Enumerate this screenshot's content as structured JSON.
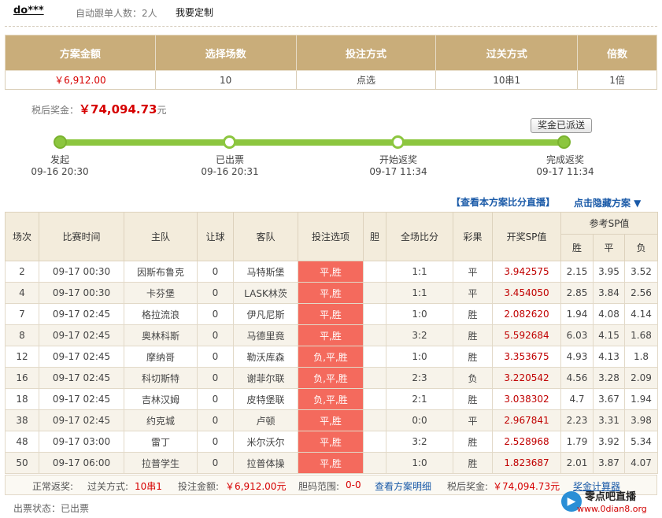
{
  "header": {
    "user": "do***",
    "auto_follow": "自动跟单人数：2人",
    "custom": "我要定制"
  },
  "summary": {
    "headers": [
      "方案金额",
      "选择场数",
      "投注方式",
      "过关方式",
      "倍数"
    ],
    "values": [
      "￥6,912.00",
      "10",
      "点选",
      "10串1",
      "1倍"
    ]
  },
  "prize": {
    "label": "税后奖金：",
    "amount": "￥74,094.73",
    "unit": "元"
  },
  "paid_button": "奖金已派送",
  "progress": [
    {
      "label": "发起",
      "time": "09-16 20:30"
    },
    {
      "label": "已出票",
      "time": "09-16 20:31"
    },
    {
      "label": "开始返奖",
      "time": "09-17 11:34"
    },
    {
      "label": "完成返奖",
      "time": "09-17 11:34"
    }
  ],
  "links": {
    "live": "【查看本方案比分直播】",
    "hide": "点击隐藏方案 ▼"
  },
  "table": {
    "headers": [
      "场次",
      "比赛时间",
      "主队",
      "让球",
      "客队",
      "投注选项",
      "胆",
      "全场比分",
      "彩果",
      "开奖SP值",
      "参考SP值"
    ],
    "sub_headers": [
      "胜",
      "平",
      "负"
    ],
    "rows": [
      [
        "2",
        "09-17 00:30",
        "因斯布鲁克",
        "0",
        "马特斯堡",
        "平,胜",
        "",
        "1:1",
        "平",
        "3.942575",
        "2.15",
        "3.95",
        "3.52"
      ],
      [
        "4",
        "09-17 00:30",
        "卡芬堡",
        "0",
        "LASK林茨",
        "平,胜",
        "",
        "1:1",
        "平",
        "3.454050",
        "2.85",
        "3.84",
        "2.56"
      ],
      [
        "7",
        "09-17 02:45",
        "格拉流浪",
        "0",
        "伊凡尼斯",
        "平,胜",
        "",
        "1:0",
        "胜",
        "2.082620",
        "1.94",
        "4.08",
        "4.14"
      ],
      [
        "8",
        "09-17 02:45",
        "奥林科斯",
        "0",
        "马德里竟",
        "平,胜",
        "",
        "3:2",
        "胜",
        "5.592684",
        "6.03",
        "4.15",
        "1.68"
      ],
      [
        "12",
        "09-17 02:45",
        "摩纳哥",
        "0",
        "勒沃库森",
        "负,平,胜",
        "",
        "1:0",
        "胜",
        "3.353675",
        "4.93",
        "4.13",
        "1.8"
      ],
      [
        "16",
        "09-17 02:45",
        "科切斯特",
        "0",
        "谢菲尔联",
        "负,平,胜",
        "",
        "2:3",
        "负",
        "3.220542",
        "4.56",
        "3.28",
        "2.09"
      ],
      [
        "18",
        "09-17 02:45",
        "吉林汉姆",
        "0",
        "皮特堡联",
        "负,平,胜",
        "",
        "2:1",
        "胜",
        "3.038302",
        "4.7",
        "3.67",
        "1.94"
      ],
      [
        "38",
        "09-17 02:45",
        "约克城",
        "0",
        "卢顿",
        "平,胜",
        "",
        "0:0",
        "平",
        "2.967841",
        "2.23",
        "3.31",
        "3.98"
      ],
      [
        "48",
        "09-17 03:00",
        "雷丁",
        "0",
        "米尔沃尔",
        "平,胜",
        "",
        "3:2",
        "胜",
        "2.528968",
        "1.79",
        "3.92",
        "5.34"
      ],
      [
        "50",
        "09-17 06:00",
        "拉普学生",
        "0",
        "拉普体操",
        "平,胜",
        "",
        "1:0",
        "胜",
        "1.823687",
        "2.01",
        "3.87",
        "4.07"
      ]
    ]
  },
  "footer": {
    "normal_prize": "正常返奖:",
    "pass_label": "过关方式:",
    "pass_value": "10串1",
    "bet_label": "投注金额:",
    "bet_value": "￥6,912.00元",
    "banker_label": "胆码范围:",
    "banker_value": "0-0",
    "detail_link": "查看方案明细",
    "after_tax_label": "税后奖金:",
    "after_tax_value": "￥74,094.73元",
    "calculator": "奖金计算器"
  },
  "status": "出票状态：已出票",
  "watermark": {
    "title": "零点吧直播",
    "url": "www.0dian8.org"
  }
}
